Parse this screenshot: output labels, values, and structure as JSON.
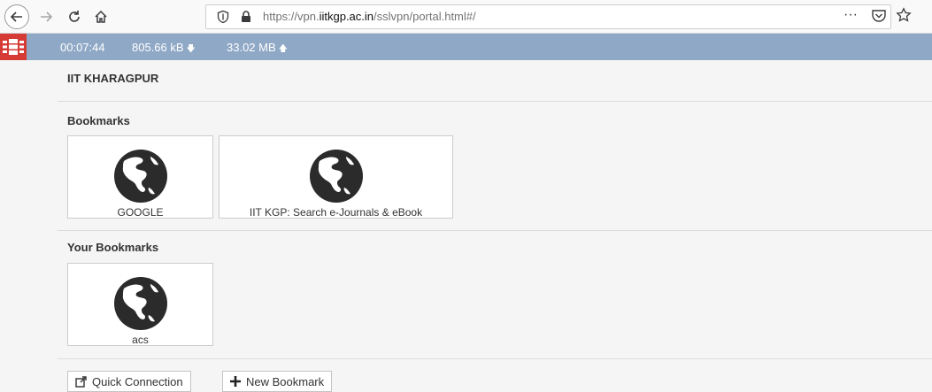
{
  "browser": {
    "url_prefix": "https://vpn.",
    "url_domain": "iitkgp.ac.in",
    "url_path": "/sslvpn/portal.html#/",
    "more_label": "···"
  },
  "status": {
    "session_time": "00:07:44",
    "downloaded": "805.66 kB",
    "uploaded": "33.02 MB"
  },
  "page": {
    "org_name": "IIT KHARAGPUR",
    "bookmarks_heading": "Bookmarks",
    "bookmarks": [
      {
        "label": "GOOGLE",
        "icon": "globe-icon"
      },
      {
        "label": "IIT KGP: Search e-Journals & eBook",
        "icon": "globe-icon"
      }
    ],
    "your_bookmarks_heading": "Your Bookmarks",
    "your_bookmarks": [
      {
        "label": "acs",
        "icon": "globe-icon"
      }
    ],
    "actions": {
      "quick_connection": "Quick Connection",
      "new_bookmark": "New Bookmark"
    }
  },
  "colors": {
    "status_bar": "#8fa8c6",
    "logo": "#d53a34",
    "globe": "#2b2b2b"
  }
}
